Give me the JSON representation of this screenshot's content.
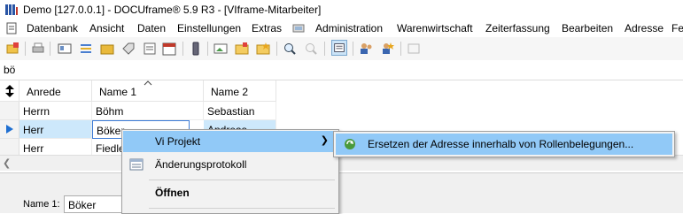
{
  "window": {
    "title": "Demo [127.0.0.1] - DOCUframe® 5.9 R3 - [VIframe-Mitarbeiter]"
  },
  "menu": {
    "items": [
      "Datenbank",
      "Ansicht",
      "Daten",
      "Einstellungen",
      "Extras",
      "Administration",
      "Warenwirtschaft",
      "Zeiterfassung",
      "Bearbeiten",
      "Adresse",
      "Fe"
    ]
  },
  "search": {
    "value": "bö"
  },
  "grid": {
    "columns": [
      "Anrede",
      "Name 1",
      "Name 2"
    ],
    "rows": [
      {
        "anrede": "Herrn",
        "name1": "Böhm",
        "name2": "Sebastian"
      },
      {
        "anrede": "Herr",
        "name1": "Böker",
        "name2": "Andreas"
      },
      {
        "anrede": "Herr",
        "name1": "Fiedler",
        "name2": ""
      }
    ]
  },
  "context_menu": {
    "items": [
      {
        "label": "Vi Projekt",
        "has_submenu": true
      },
      {
        "label": "Änderungsprotokoll"
      },
      {
        "label": "Öffnen"
      }
    ],
    "submenu": {
      "label": "Ersetzen der Adresse innerhalb von Rollenbelegungen..."
    }
  },
  "detail": {
    "name1_label": "Name 1:",
    "name1_value": "Böker"
  },
  "colors": {
    "highlight": "#91c9f7",
    "selected_row": "#cde8fb",
    "menu_bg": "#f2f2f2"
  }
}
